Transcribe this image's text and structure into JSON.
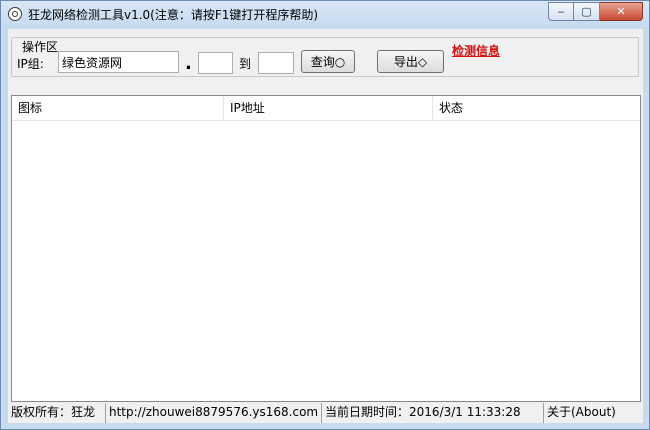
{
  "window": {
    "title": "狂龙网络检测工具v1.0(注意：请按F1键打开程序帮助)",
    "controls": {
      "minimize": "‒",
      "maximize": "▢",
      "close": "✕"
    }
  },
  "toolbar": {
    "group_label": "操作区",
    "ip_label": "IP组:",
    "ip_value": "绿色资源网",
    "range_start": "",
    "range_end": "",
    "dot": ".",
    "to_label": "到",
    "query_button": "查询○",
    "export_button": "导出◇",
    "check_link": "检测信息"
  },
  "list": {
    "columns": [
      "图标",
      "IP地址",
      "状态"
    ],
    "rows": []
  },
  "statusbar": {
    "copyright": "版权所有：狂龙",
    "url": "http://zhouwei8879576.ys168.com",
    "datetime": "当前日期时间：2016/3/1 11:33:28",
    "about": "关于(About)"
  },
  "colors": {
    "link": "#d41010",
    "frame": "#c7daee",
    "client": "#f0f0f0"
  }
}
